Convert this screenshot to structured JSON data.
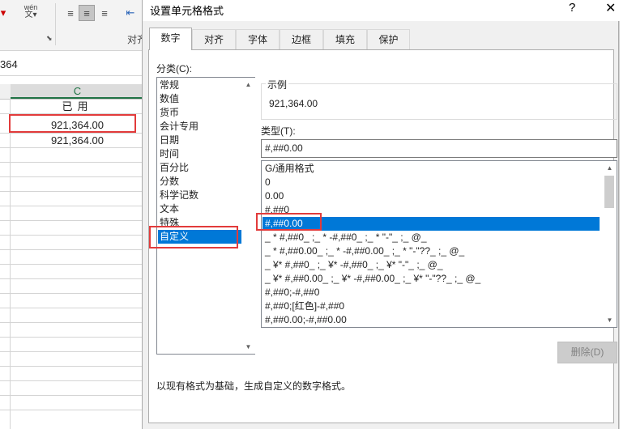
{
  "excel": {
    "name_box_fragment": "364",
    "column_header": "C",
    "group_label": "对齐",
    "wen_button": "wén",
    "cells": [
      {
        "row": "header",
        "value": "已用"
      },
      {
        "row": "1",
        "value": "921,364.00"
      },
      {
        "row": "2",
        "value": "921,364.00"
      }
    ]
  },
  "dialog": {
    "title": "设置单元格格式",
    "help": "?",
    "close": "✕",
    "tabs": [
      "数字",
      "对齐",
      "字体",
      "边框",
      "填充",
      "保护"
    ],
    "active_tab": "数字",
    "category_label": "分类(C):",
    "categories": [
      "常规",
      "数值",
      "货币",
      "会计专用",
      "日期",
      "时间",
      "百分比",
      "分数",
      "科学记数",
      "文本",
      "特殊",
      "自定义"
    ],
    "selected_category": "自定义",
    "sample_legend": "示例",
    "sample_value": "921,364.00",
    "type_label": "类型(T):",
    "type_value": "#,##0.00",
    "formats": [
      "G/通用格式",
      "0",
      "0.00",
      "#,##0",
      "#,##0.00",
      "_ * #,##0_ ;_ * -#,##0_ ;_ * \"-\"_ ;_ @_",
      "_ * #,##0.00_ ;_ * -#,##0.00_ ;_ * \"-\"??_ ;_ @_",
      "_ ¥* #,##0_ ;_ ¥* -#,##0_ ;_ ¥* \"-\"_ ;_ @_",
      "_ ¥* #,##0.00_ ;_ ¥* -#,##0.00_ ;_ ¥* \"-\"??_ ;_ @_",
      "#,##0;-#,##0",
      "#,##0;[红色]-#,##0",
      "#,##0.00;-#,##0.00"
    ],
    "selected_format": "#,##0.00",
    "delete_button": "删除(D)",
    "description": "以现有格式为基础，生成自定义的数字格式。"
  },
  "colors": {
    "selection": "#0078d7",
    "highlight_box": "#e23b3b",
    "excel_green": "#217346"
  }
}
